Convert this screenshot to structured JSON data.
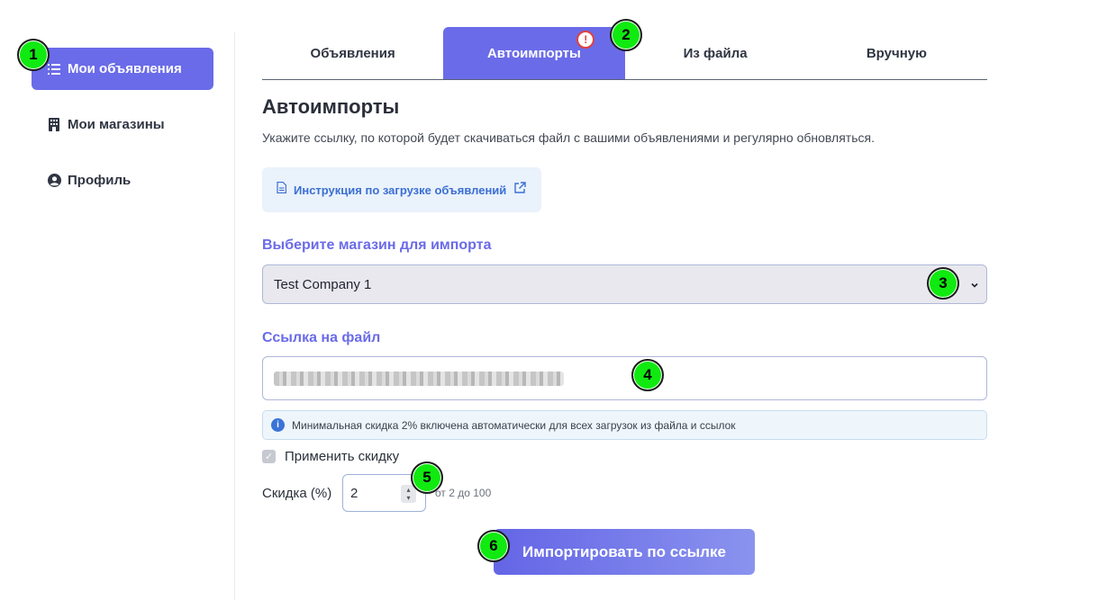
{
  "sidebar": {
    "items": [
      {
        "label": "Мои объявления",
        "icon": "list-icon",
        "active": true
      },
      {
        "label": "Мои магазины",
        "icon": "building-icon",
        "active": false
      },
      {
        "label": "Профиль",
        "icon": "user-circle-icon",
        "active": false
      }
    ]
  },
  "tabs": [
    {
      "label": "Объявления",
      "active": false
    },
    {
      "label": "Автоимпорты",
      "active": true,
      "badge": "!"
    },
    {
      "label": "Из файла",
      "active": false
    },
    {
      "label": "Вручную",
      "active": false
    }
  ],
  "main": {
    "title": "Автоимпорты",
    "description": "Укажите ссылку, по которой будет скачиваться файл с вашими объявлениями и регулярно обновляться.",
    "guide_link": "Инструкция по загрузке объявлений",
    "shop_label": "Выберите магазин для импорта",
    "shop_selected": "Test Company 1",
    "file_link_label": "Ссылка на файл",
    "info_text": "Минимальная скидка 2% включена автоматически для всех загрузок из файла и ссылок",
    "apply_discount_label": "Применить скидку",
    "apply_discount_checked": true,
    "discount_label": "Скидка (%)",
    "discount_value": "2",
    "discount_hint": "от 2 до 100",
    "import_button": "Импортировать по ссылке"
  },
  "markers": [
    "1",
    "2",
    "3",
    "4",
    "5",
    "6"
  ],
  "colors": {
    "accent": "#6a6be8",
    "link": "#3b6fd4",
    "marker": "#10ea10",
    "warning": "#e04040"
  }
}
